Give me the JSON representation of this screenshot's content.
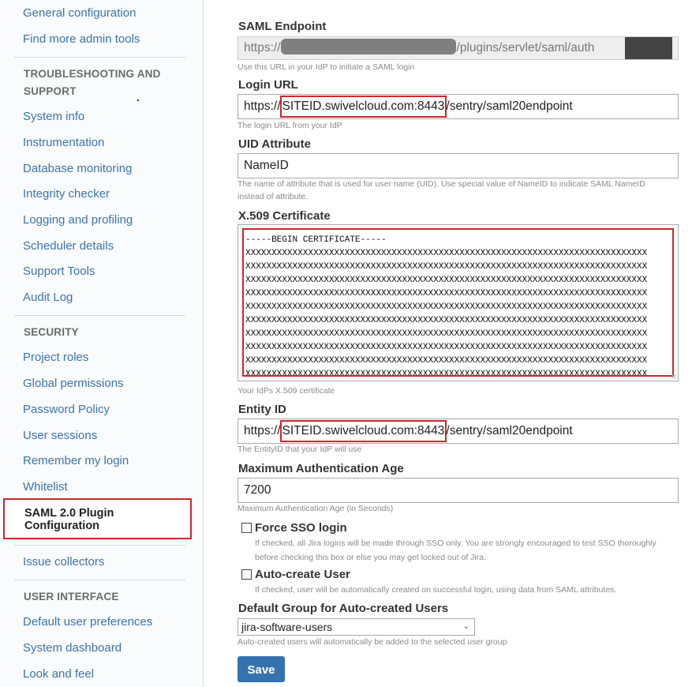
{
  "sidebar": {
    "top_links": [
      {
        "label": "General configuration"
      },
      {
        "label": "Find more admin tools"
      }
    ],
    "sections": [
      {
        "heading": "TROUBLESHOOTING AND SUPPORT",
        "items": [
          {
            "label": "System info"
          },
          {
            "label": "Instrumentation"
          },
          {
            "label": "Database monitoring"
          },
          {
            "label": "Integrity checker"
          },
          {
            "label": "Logging and profiling"
          },
          {
            "label": "Scheduler details"
          },
          {
            "label": "Support Tools"
          },
          {
            "label": "Audit Log"
          }
        ]
      },
      {
        "heading": "SECURITY",
        "items": [
          {
            "label": "Project roles"
          },
          {
            "label": "Global permissions"
          },
          {
            "label": "Password Policy"
          },
          {
            "label": "User sessions"
          },
          {
            "label": "Remember my login"
          },
          {
            "label": "Whitelist"
          },
          {
            "label": "SAML 2.0 Plugin Configuration",
            "active": true
          }
        ]
      },
      {
        "heading": "",
        "items": [
          {
            "label": "Issue collectors"
          }
        ]
      },
      {
        "heading": "USER INTERFACE",
        "items": [
          {
            "label": "Default user preferences"
          },
          {
            "label": "System dashboard"
          },
          {
            "label": "Look and feel"
          }
        ]
      }
    ]
  },
  "form": {
    "saml_endpoint": {
      "label": "SAML Endpoint",
      "prefix": "https://",
      "suffix": "/plugins/servlet/saml/auth",
      "help": "Use this URL in your IdP to initiate a SAML login"
    },
    "login_url": {
      "label": "Login URL",
      "prefix": "https://",
      "highlighted": "SITEID.swivelcloud.com:8443",
      "suffix": "/sentry/saml20endpoint",
      "help": "The login URL from your IdP"
    },
    "uid_attribute": {
      "label": "UID Attribute",
      "value": "NameID",
      "help": "The name of attribute that is used for user name (UID). Use special value of NameID to indicate SAML NameID instead of attribute."
    },
    "certificate": {
      "label": "X.509 Certificate",
      "first_line": "-----BEGIN CERTIFICATE-----",
      "body_line": "XXXXXXXXXXXXXXXXXXXXXXXXXXXXXXXXXXXXXXXXXXXXXXXXXXXXXXXXXXXXXXXXXXXXXXXXXXXXX",
      "body_line_count": 10,
      "help": "Your IdPs X.509 certificate"
    },
    "entity_id": {
      "label": "Entity ID",
      "prefix": "https://",
      "highlighted": "SITEID.swivelcloud.com:8443",
      "suffix": "/sentry/saml20endpoint",
      "help": "The EntityID that your IdP will use"
    },
    "max_auth_age": {
      "label": "Maximum Authentication Age",
      "value": "7200",
      "help": "Maximum Authentication Age (in Seconds)"
    },
    "force_sso": {
      "label": "Force SSO login",
      "checked": false,
      "help": "If checked, all Jira logins will be made through SSO only. You are strongly encouraged to test SSO thoroughly before checking this box or else you may get locked out of Jira."
    },
    "auto_create": {
      "label": "Auto-create User",
      "checked": false,
      "help": "If checked, user will be automatically created on successful login, using data from SAML attributes."
    },
    "default_group": {
      "label": "Default Group for Auto-created Users",
      "selected": "jira-software-users",
      "help": "Auto-created users will automatically be added to the selected user group"
    },
    "save_label": "Save"
  },
  "colors": {
    "link": "#3b73af",
    "highlight_border": "#d0262d",
    "primary_button": "#3572b0"
  }
}
